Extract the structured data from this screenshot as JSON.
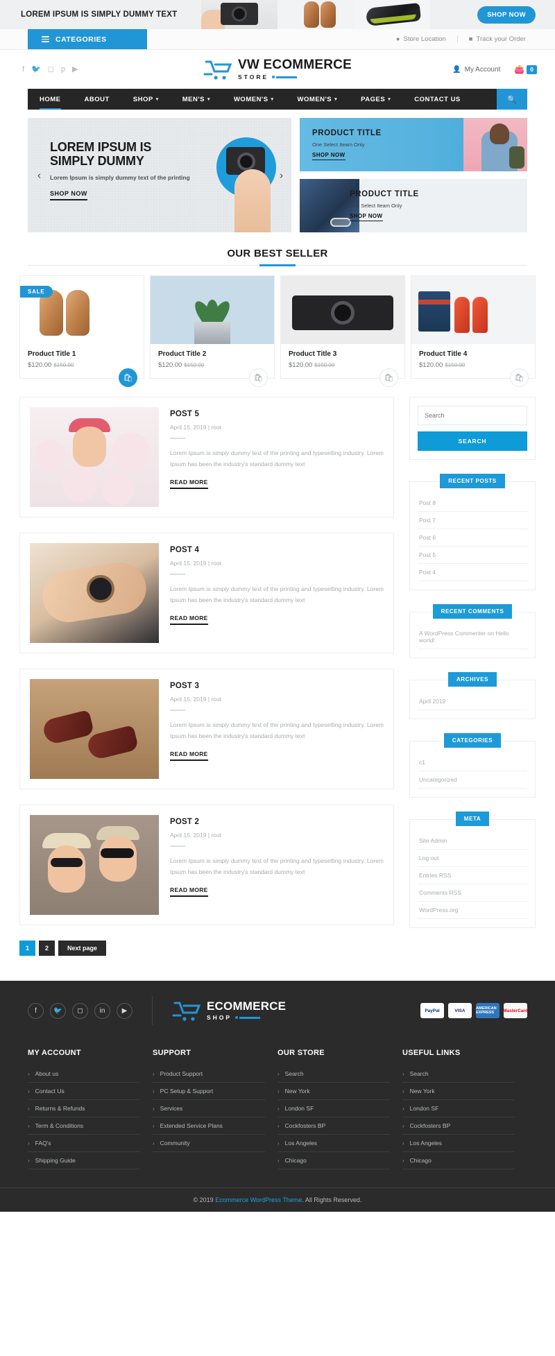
{
  "topbar": {
    "promo_text": "LOREM IPSUM IS SIMPLY DUMMY TEXT",
    "shop_now": "SHOP NOW"
  },
  "categories_bar": {
    "categories_label": "CATEGORIES",
    "store_location": "Store Location",
    "track_order": "Track your Order"
  },
  "header": {
    "socials": [
      "f",
      "t",
      "ig",
      "p",
      "yt"
    ],
    "brand_main": "VW ECOMMERCE",
    "brand_sub": "STORE",
    "my_account": "My Account",
    "cart_count": "0"
  },
  "nav": {
    "items": [
      {
        "label": "HOME",
        "caret": false,
        "active": true
      },
      {
        "label": "ABOUT",
        "caret": false,
        "active": false
      },
      {
        "label": "SHOP",
        "caret": true,
        "active": false
      },
      {
        "label": "MEN'S",
        "caret": true,
        "active": false
      },
      {
        "label": "WOMEN'S",
        "caret": true,
        "active": false
      },
      {
        "label": "WOMEN'S",
        "caret": true,
        "active": false
      },
      {
        "label": "PAGES",
        "caret": true,
        "active": false
      },
      {
        "label": "CONTACT US",
        "caret": false,
        "active": false
      }
    ],
    "search_icon": "search-icon"
  },
  "hero": {
    "heading": "LOREM IPSUM IS SIMPLY DUMMY",
    "subtext": "Lorem Ipsum is simply dummy text of the printing",
    "cta": "SHOP NOW",
    "prev": "‹",
    "next": "›"
  },
  "promos": [
    {
      "title": "PRODUCT TITLE",
      "subtitle": "One  Select Iteam Only",
      "cta": "SHOP NOW"
    },
    {
      "title": "PRODUCT TITLE",
      "subtitle": "One  Select Iteam Only",
      "cta": "SHOP NOW"
    }
  ],
  "best_seller": {
    "title": "OUR BEST SELLER",
    "products": [
      {
        "title": "Product Title 1",
        "price": "$120.00",
        "old_price": "$150.00",
        "badge": "SALE",
        "cart_active": true
      },
      {
        "title": "Product Title 2",
        "price": "$120.00",
        "old_price": "$150.00",
        "badge": "",
        "cart_active": false
      },
      {
        "title": "Product Title 3",
        "price": "$120.00",
        "old_price": "$150.00",
        "badge": "",
        "cart_active": false
      },
      {
        "title": "Product Title 4",
        "price": "$120.00",
        "old_price": "$150.00",
        "badge": "",
        "cart_active": false
      }
    ]
  },
  "posts": [
    {
      "title": "POST 5",
      "meta": "April 15, 2019 |  root",
      "excerpt": "Lorem Ipsum is simply dummy text of the printing and typesetting industry. Lorem Ipsum has been the industry's standard dummy text",
      "read_more": "READ MORE"
    },
    {
      "title": "POST 4",
      "meta": "April 15, 2019 |  root",
      "excerpt": "Lorem Ipsum is simply dummy text of the printing and typesetting industry. Lorem Ipsum has been the industry's standard dummy text",
      "read_more": "READ MORE"
    },
    {
      "title": "POST 3",
      "meta": "April 15, 2019 |  root",
      "excerpt": "Lorem Ipsum is simply dummy text of the printing and typesetting industry. Lorem Ipsum has been the industry's standard dummy text",
      "read_more": "READ MORE"
    },
    {
      "title": "POST 2",
      "meta": "April 15, 2019 |  root",
      "excerpt": "Lorem Ipsum is simply dummy text of the printing and typesetting industry. Lorem Ipsum has been the industry's standard dummy text",
      "read_more": "READ MORE"
    }
  ],
  "pagination": {
    "current": "1",
    "page2": "2",
    "next": "Next page"
  },
  "sidebar": {
    "search": {
      "placeholder": "Search",
      "button": "SEARCH"
    },
    "recent_posts": {
      "title": "RECENT POSTS",
      "items": [
        "Post 8",
        "Post 7",
        "Post 6",
        "Post 5",
        "Post 4"
      ]
    },
    "recent_comments": {
      "title": "RECENT COMMENTS",
      "items": [
        "A WordPress Commenter on Hello world!"
      ]
    },
    "archives": {
      "title": "ARCHIVES",
      "items": [
        "April 2019"
      ]
    },
    "categories": {
      "title": "CATEGORIES",
      "items": [
        "c1",
        "Uncategorized"
      ]
    },
    "meta": {
      "title": "META",
      "items": [
        "Site Admin",
        "Log out",
        "Entries RSS",
        "Comments RSS",
        "WordPress.org"
      ]
    }
  },
  "footer": {
    "brand_main": "ECOMMERCE",
    "brand_sub": "SHOP",
    "socials": [
      "f",
      "t",
      "ig",
      "in",
      "yt"
    ],
    "payments": [
      "PayPal",
      "VISA",
      "AMERICAN EXPRESS",
      "MasterCard"
    ],
    "columns": [
      {
        "title": "MY ACCOUNT",
        "items": [
          "About us",
          "Contact Us",
          "Returns & Refunds",
          "Term & Conditions",
          "FAQ's",
          "Shipping Guide"
        ]
      },
      {
        "title": "SUPPORT",
        "items": [
          "Product Support",
          "PC Setup & Support",
          "Services",
          "Extended Service Plans",
          "Community"
        ]
      },
      {
        "title": "OUR STORE",
        "items": [
          "Search",
          "New York",
          "London SF",
          "Cockfosters BP",
          "Los Angeles",
          "Chicago"
        ]
      },
      {
        "title": "USEFUL LINKS",
        "items": [
          "Search",
          "New York",
          "London SF",
          "Cockfosters BP",
          "Los Angeles",
          "Chicago"
        ]
      }
    ],
    "copyright_pre": "© 2019 ",
    "copyright_link": "Ecommerce WordPress Theme",
    "copyright_post": ". All Rights Reserved."
  }
}
